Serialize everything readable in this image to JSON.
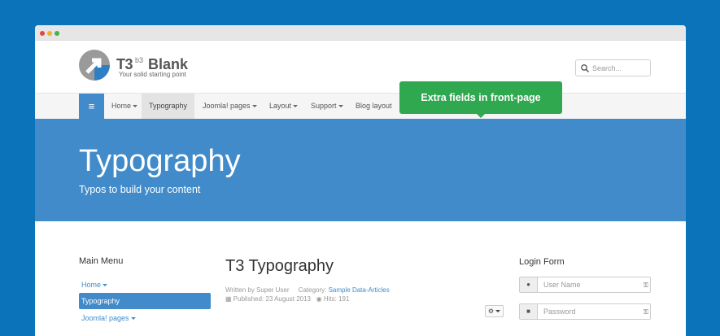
{
  "logo": {
    "main": "T3",
    "superscript": "b3",
    "word": "Blank",
    "tagline": "Your solid starting point"
  },
  "search": {
    "placeholder": "Search..."
  },
  "nav": {
    "toggle_icon": "≡",
    "items": [
      {
        "label": "Home"
      },
      {
        "label": "Typography"
      },
      {
        "label": "Joomla! pages"
      },
      {
        "label": "Layout"
      },
      {
        "label": "Support"
      },
      {
        "label": "Blog layout"
      }
    ]
  },
  "tooltip": {
    "text": "Extra fields in front-page"
  },
  "masthead": {
    "title": "Typography",
    "subtitle": "Typos to build your content"
  },
  "sidebar": {
    "title": "Main Menu",
    "items": [
      {
        "label": "Home"
      },
      {
        "label": "Typography"
      },
      {
        "label": "Joomla! pages"
      }
    ]
  },
  "article": {
    "title": "T3 Typography",
    "written_by": "Written by Super User",
    "category_label": "Category:",
    "category_link": "Sample Data-Articles",
    "published": "Published: 23 August 2013",
    "hits": "Hits: 191"
  },
  "login": {
    "title": "Login Form",
    "username_placeholder": "User Name",
    "password_placeholder": "Password"
  },
  "colors": {
    "background": "#0a73ba",
    "primary": "#428bca",
    "tooltip": "#2fa84f"
  }
}
